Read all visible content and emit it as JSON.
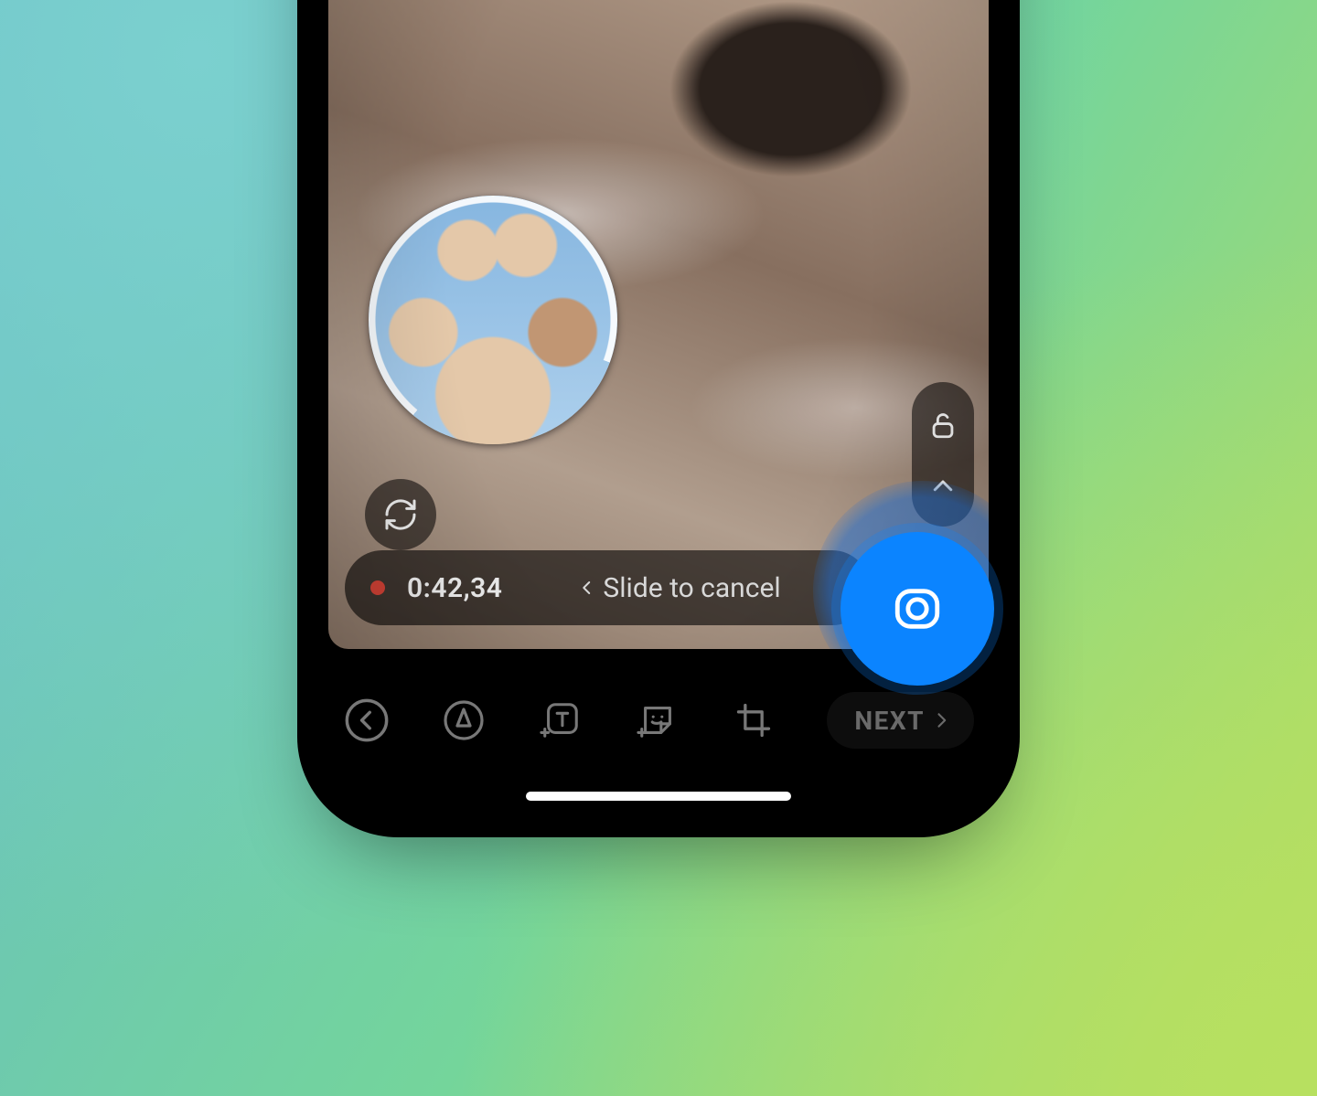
{
  "recording": {
    "timer": "0:42,34",
    "slide_label": "Slide to cancel"
  },
  "toolbar": {
    "next_label": "NEXT"
  },
  "icons": {
    "flip": "camera-flip-icon",
    "lock": "lock-open-icon",
    "chevron_up": "chevron-up-icon",
    "chevron_left": "chevron-left-icon",
    "chevron_right": "chevron-right-icon",
    "capture": "camera-capture-icon",
    "back": "back-icon",
    "draw": "draw-icon",
    "text": "add-text-icon",
    "sticker": "add-sticker-icon",
    "crop": "crop-icon"
  },
  "colors": {
    "accent": "#0b84ff",
    "recording_dot": "#e33b2e"
  }
}
